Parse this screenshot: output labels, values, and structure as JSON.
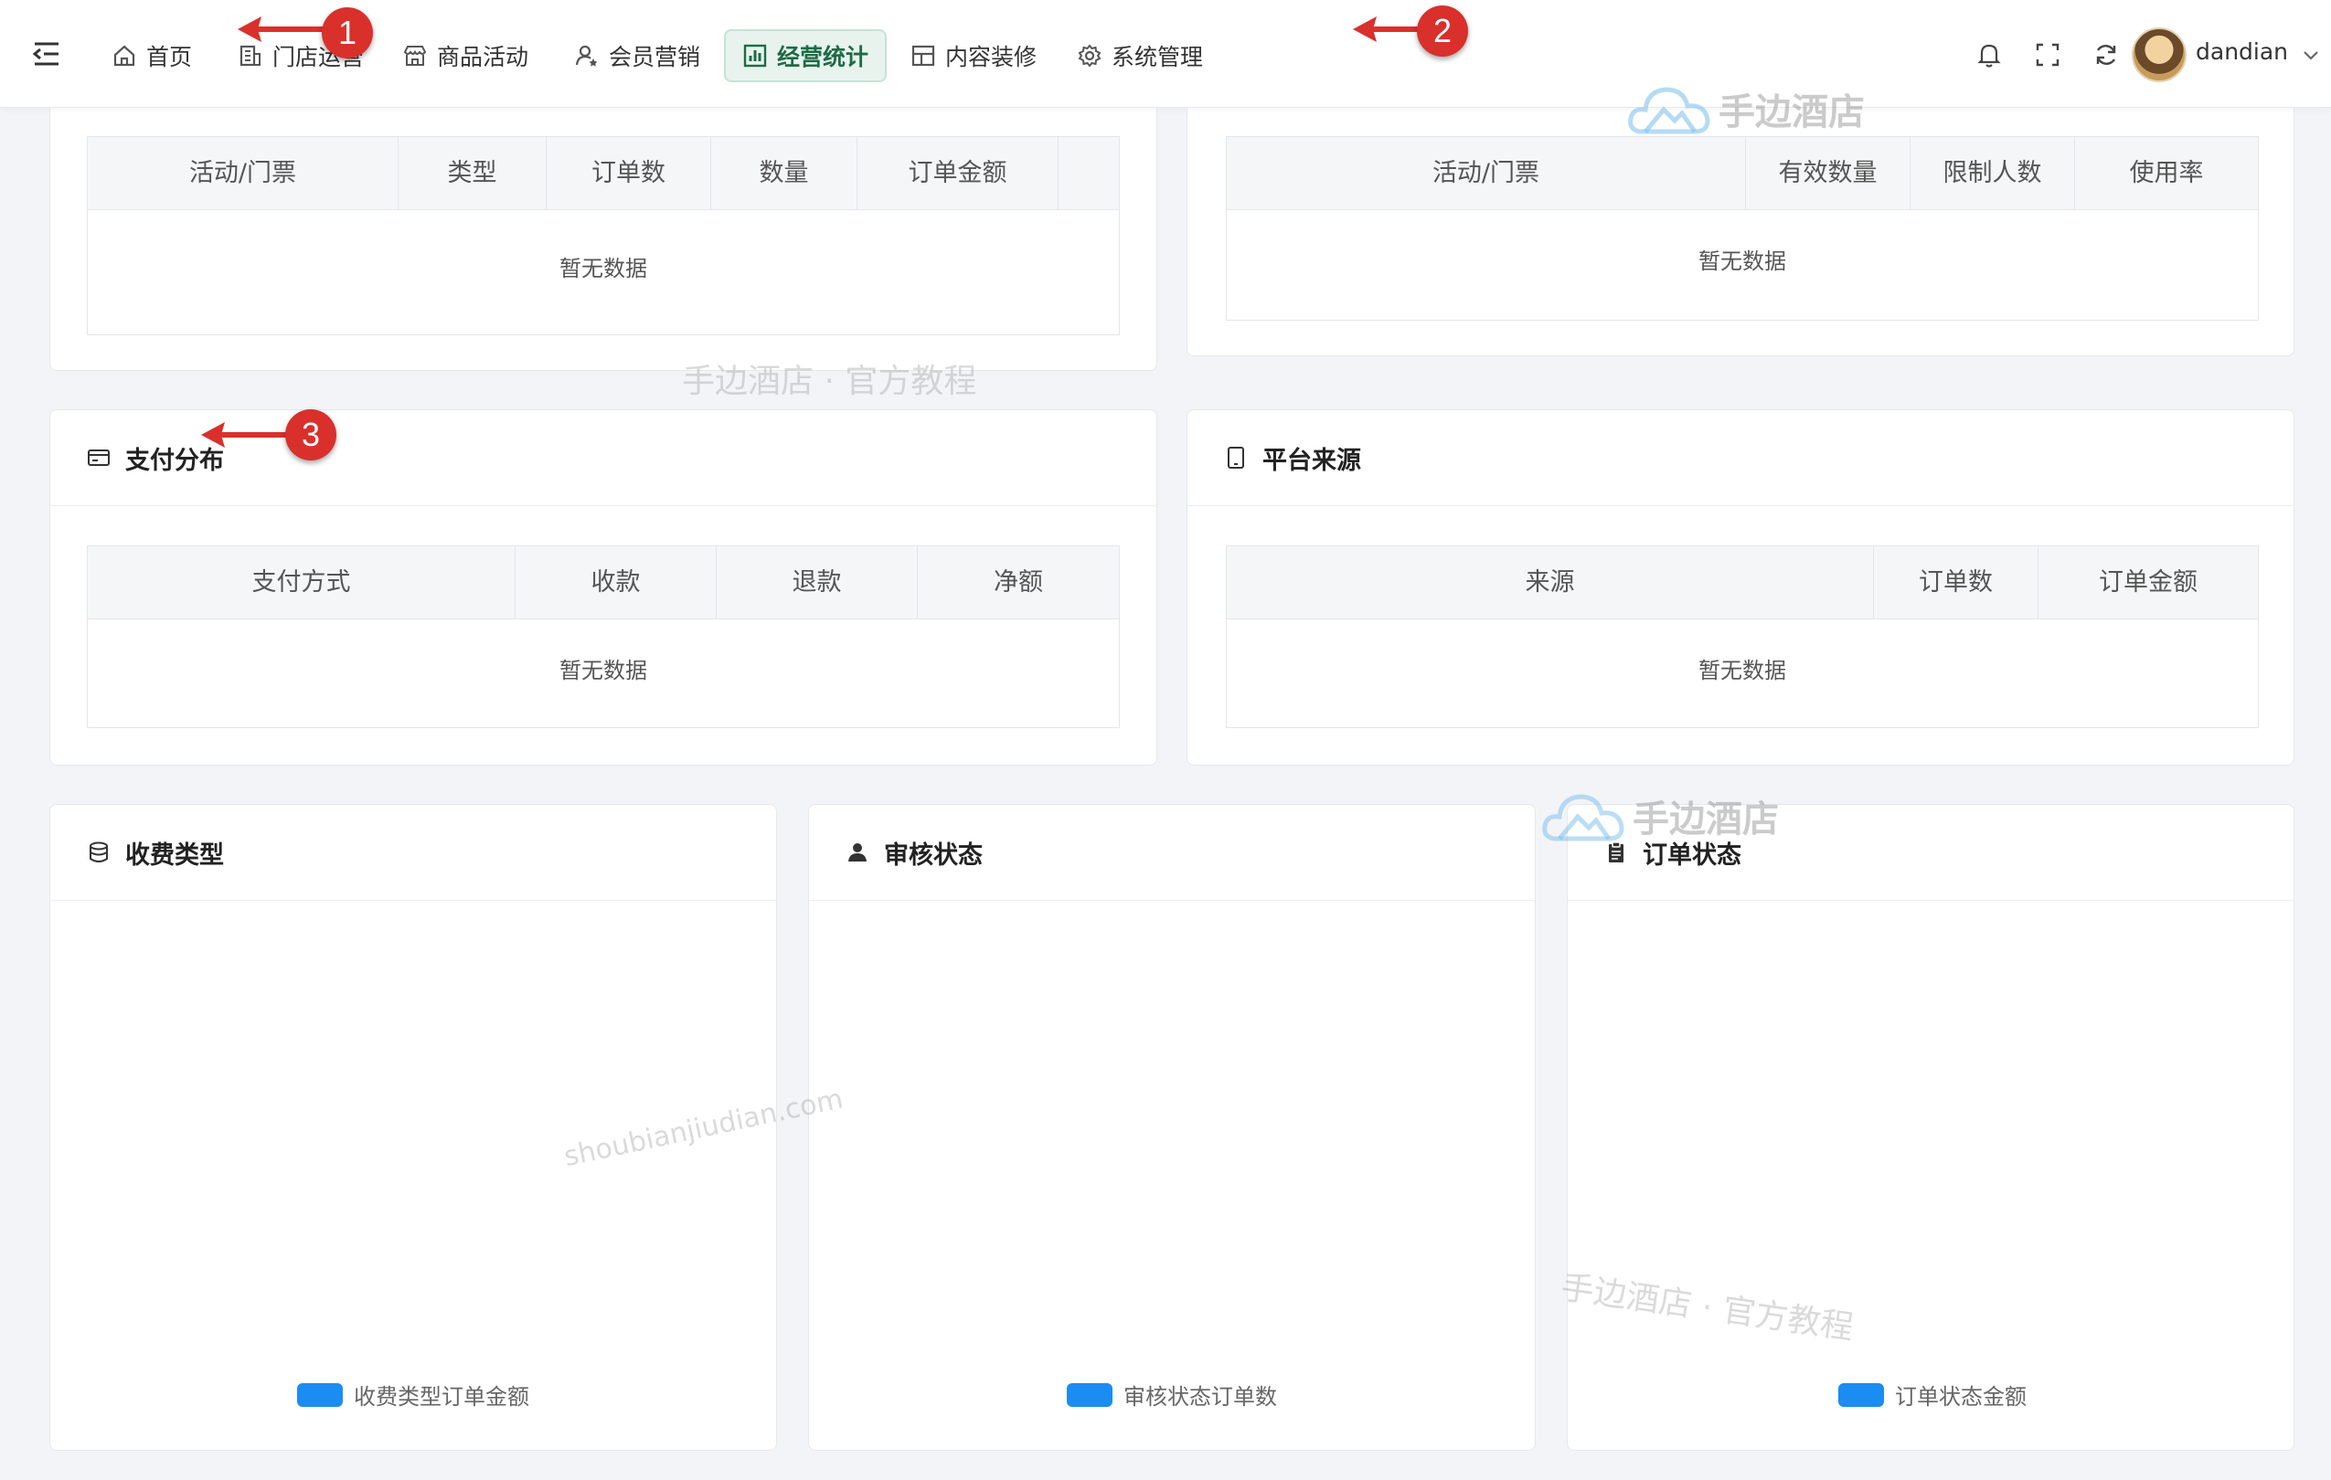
{
  "nav": {
    "items": [
      {
        "label": "首页",
        "icon": "home-icon"
      },
      {
        "label": "门店运营",
        "icon": "store-building-icon"
      },
      {
        "label": "商品活动",
        "icon": "shop-icon"
      },
      {
        "label": "会员营销",
        "icon": "member-icon"
      },
      {
        "label": "经营统计",
        "icon": "bar-chart-icon",
        "active": true
      },
      {
        "label": "内容装修",
        "icon": "layout-icon"
      },
      {
        "label": "系统管理",
        "icon": "gear-icon"
      }
    ],
    "accent_color": "#1e6b46"
  },
  "user": {
    "name": "dandian"
  },
  "activity_tickets": {
    "columns": [
      "活动/门票",
      "类型",
      "订单数",
      "数量",
      "订单金额"
    ],
    "empty": "暂无数据"
  },
  "ticket_usage": {
    "columns": [
      "活动/门票",
      "有效数量",
      "限制人数",
      "使用率"
    ],
    "empty": "暂无数据"
  },
  "payment": {
    "title": "支付分布",
    "columns": [
      "支付方式",
      "收款",
      "退款",
      "净额"
    ],
    "empty": "暂无数据"
  },
  "platform": {
    "title": "平台来源",
    "columns": [
      "来源",
      "订单数",
      "订单金额"
    ],
    "empty": "暂无数据"
  },
  "charts": [
    {
      "title": "收费类型",
      "legend": "收费类型订单金额",
      "color": "#1b8cf2"
    },
    {
      "title": "审核状态",
      "legend": "审核状态订单数",
      "color": "#1b8cf2"
    },
    {
      "title": "订单状态",
      "legend": "订单状态金额",
      "color": "#1b8cf2"
    }
  ],
  "annotations": [
    "1",
    "2",
    "3"
  ],
  "watermarks": {
    "brand": "手边酒店",
    "tagline": "手边酒店 · 官方教程",
    "url": "shoubianjiudian.com"
  }
}
